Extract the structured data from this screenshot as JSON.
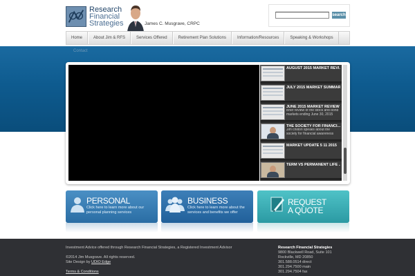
{
  "header": {
    "logo": {
      "line1": "Research",
      "line2": "Financial",
      "line3": "Strategies"
    },
    "advisor_name": "James C. Musgrave, CRPC",
    "search": {
      "placeholder": "",
      "value": "",
      "button_label": "search"
    }
  },
  "nav": {
    "items": [
      {
        "label": "Home"
      },
      {
        "label": "About Jim & RFS"
      },
      {
        "label": "Services Offered"
      },
      {
        "label": "Retirement Plan Solutions"
      },
      {
        "label": "Information/Resources"
      },
      {
        "label": "Speaking & Workshops"
      }
    ],
    "overflow_item": "Contact"
  },
  "playlist": {
    "items": [
      {
        "title": "AUGUST 2015 MARKET REVI...",
        "desc": "",
        "thumb": "chart"
      },
      {
        "title": "JULY 2015 MARKET SUMMAR...",
        "desc": "",
        "thumb": "chart"
      },
      {
        "title": "JUNE 2015 MARKET REVIEW",
        "desc": "Brief review of the stock and bond markets ending June 30, 2015",
        "thumb": "chart"
      },
      {
        "title": "THE SOCIETY FOR FINANCI...",
        "desc": "Jim chilton speaks about the society for financial awareness",
        "thumb": "person"
      },
      {
        "title": "MARKET UPDATE 5 11 2015",
        "desc": "",
        "thumb": "chart"
      },
      {
        "title": "TERM VS PERMANENT LIFE ...",
        "desc": "",
        "thumb": "person"
      }
    ]
  },
  "ctas": {
    "personal": {
      "title": "PERSONAL",
      "text": "Click here to learn more about our personal planning services",
      "icon": "person-icon"
    },
    "business": {
      "title": "BUSINESS",
      "text": "Click here to learn more about the services and benefits we offer",
      "icon": "group-icon"
    },
    "quote": {
      "title_line1": "REQUEST",
      "title_line2": "A QUOTE",
      "icon": "pen-icon"
    }
  },
  "footer": {
    "disclaimer": "Investment Advice offered through Research Financial Strategies, a Registered Investment Advisor",
    "copyright": "©2014 Jim Musgrave. All rights reserved.",
    "design_prefix": "Site Design by ",
    "design_link": "UDIO Edge",
    "terms": "Terms & Conditions",
    "company": "Research Financial Strategies",
    "address_line1": "9800 Blackwell Road, Suite 101",
    "address_line2": "Rockville, MD 20850",
    "phone_direct": "301.588.0514 direct",
    "phone_main": "301.294.7500 main",
    "fax": "301.294.7504 fax"
  },
  "colors": {
    "band": "#0e5b8f",
    "personal": "#2a6da4",
    "business": "#21609a",
    "quote": "#2b9aa3",
    "footer": "#2f3034"
  }
}
